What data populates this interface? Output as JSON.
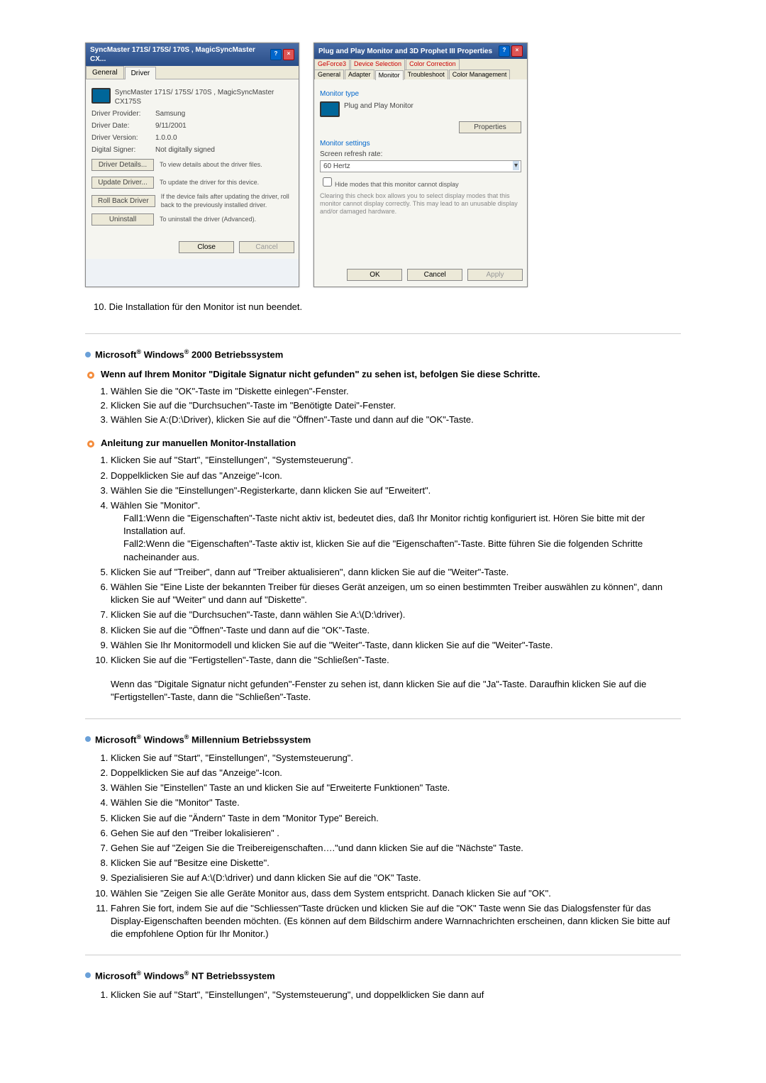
{
  "dialog1": {
    "title": "SyncMaster 171S/ 175S/ 170S , MagicSyncMaster CX...",
    "tabs": [
      "General",
      "Driver"
    ],
    "model": "SyncMaster 171S/ 175S/ 170S , MagicSyncMaster CX175S",
    "provider_lbl": "Driver Provider:",
    "provider_val": "Samsung",
    "date_lbl": "Driver Date:",
    "date_val": "9/11/2001",
    "version_lbl": "Driver Version:",
    "version_val": "1.0.0.0",
    "signer_lbl": "Digital Signer:",
    "signer_val": "Not digitally signed",
    "btn_details": "Driver Details...",
    "btn_details_desc": "To view details about the driver files.",
    "btn_update": "Update Driver...",
    "btn_update_desc": "To update the driver for this device.",
    "btn_rollback": "Roll Back Driver",
    "btn_rollback_desc": "If the device fails after updating the driver, roll back to the previously installed driver.",
    "btn_uninstall": "Uninstall",
    "btn_uninstall_desc": "To uninstall the driver (Advanced).",
    "btn_close": "Close",
    "btn_cancel": "Cancel"
  },
  "dialog2": {
    "title": "Plug and Play Monitor and 3D Prophet III Properties",
    "tabs_row1": [
      "GeForce3",
      "Device Selection",
      "Color Correction"
    ],
    "tabs_row2": [
      "General",
      "Adapter",
      "Monitor",
      "Troubleshoot",
      "Color Management"
    ],
    "group_monitor_type": "Monitor type",
    "monitor_name": "Plug and Play Monitor",
    "btn_properties": "Properties",
    "group_settings": "Monitor settings",
    "refresh_lbl": "Screen refresh rate:",
    "refresh_val": "60 Hertz",
    "hide_modes": "Hide modes that this monitor cannot display",
    "hint": "Clearing this check box allows you to select display modes that this monitor cannot display correctly. This may lead to an unusable display and/or damaged hardware.",
    "btn_ok": "OK",
    "btn_cancel": "Cancel",
    "btn_apply": "Apply"
  },
  "step10": "10.   Die Installation für den Monitor ist nun beendet.",
  "sec2000": {
    "heading_pre": "Microsoft",
    "heading_mid": " Windows",
    "heading_post": " 2000 Betriebssystem",
    "sub1": "Wenn auf Ihrem Monitor \"Digitale Signatur nicht gefunden\" zu sehen ist, befolgen Sie diese Schritte.",
    "s1": [
      "Wählen Sie die \"OK\"-Taste im \"Diskette einlegen\"-Fenster.",
      "Klicken Sie auf die \"Durchsuchen\"-Taste im \"Benötigte Datei\"-Fenster.",
      "Wählen Sie A:(D:\\Driver), klicken Sie auf die \"Öffnen\"-Taste und dann auf die \"OK\"-Taste."
    ],
    "sub2": "Anleitung zur manuellen Monitor-Installation",
    "s2_1": "Klicken Sie auf \"Start\", \"Einstellungen\", \"Systemsteuerung\".",
    "s2_2": "Doppelklicken Sie auf das \"Anzeige\"-Icon.",
    "s2_3": "Wählen Sie die \"Einstellungen\"-Registerkarte, dann klicken Sie auf \"Erweitert\".",
    "s2_4": "Wählen Sie \"Monitor\".",
    "fall1_lbl": "Fall1:",
    "fall1": "Wenn die \"Eigenschaften\"-Taste nicht aktiv ist, bedeutet dies, daß Ihr Monitor richtig konfiguriert ist. Hören Sie bitte mit der Installation auf.",
    "fall2_lbl": "Fall2:",
    "fall2": "Wenn die \"Eigenschaften\"-Taste aktiv ist, klicken Sie auf die \"Eigenschaften\"-Taste. Bitte führen Sie die folgenden Schritte nacheinander aus.",
    "s2_5": "Klicken Sie auf \"Treiber\", dann auf \"Treiber aktualisieren\", dann klicken Sie auf die \"Weiter\"-Taste.",
    "s2_6": "Wählen Sie \"Eine Liste der bekannten Treiber für dieses Gerät anzeigen, um so einen bestimmten Treiber auswählen zu können\", dann klicken Sie auf \"Weiter\" und dann auf \"Diskette\".",
    "s2_7": "Klicken Sie auf die \"Durchsuchen\"-Taste, dann wählen Sie A:\\(D:\\driver).",
    "s2_8": "Klicken Sie auf die \"Öffnen\"-Taste und dann auf die \"OK\"-Taste.",
    "s2_9": "Wählen Sie Ihr Monitormodell und klicken Sie auf die \"Weiter\"-Taste, dann klicken Sie auf die \"Weiter\"-Taste.",
    "s2_10": "Klicken Sie auf die \"Fertigstellen\"-Taste, dann die \"Schließen\"-Taste.",
    "s2_after": "Wenn das \"Digitale Signatur nicht gefunden\"-Fenster zu sehen ist, dann klicken Sie auf die \"Ja\"-Taste. Daraufhin klicken Sie auf die \"Fertigstellen\"-Taste, dann die \"Schließen\"-Taste."
  },
  "secME": {
    "heading_post": " Millennium Betriebssystem",
    "s": [
      "Klicken Sie auf \"Start\", \"Einstellungen\", \"Systemsteuerung\".",
      "Doppelklicken Sie auf das \"Anzeige\"-Icon.",
      "Wählen Sie \"Einstellen\" Taste an und klicken Sie auf \"Erweiterte Funktionen\" Taste.",
      "Wählen Sie die \"Monitor\" Taste.",
      "Klicken Sie auf die \"Ändern\" Taste in dem \"Monitor Type\" Bereich.",
      "Gehen Sie auf den \"Treiber lokalisieren\" .",
      "Gehen Sie auf \"Zeigen Sie die Treibereigenschaften….\"und dann klicken Sie auf die \"Nächste\" Taste.",
      "Klicken Sie auf \"Besitze eine Diskette\".",
      "Spezialisieren Sie auf A:\\(D:\\driver) und dann klicken Sie auf die \"OK\" Taste.",
      "Wählen Sie \"Zeigen Sie alle Geräte Monitor aus, dass dem System entspricht. Danach klicken Sie auf \"OK\".",
      "Fahren Sie fort, indem Sie auf die \"Schliessen\"Taste drücken und klicken Sie auf die \"OK\" Taste wenn Sie das Dialogsfenster für das Display-Eigenschaften beenden möchten. (Es können auf dem Bildschirm andere Warnnachrichten erscheinen, dann klicken Sie bitte auf die empfohlene Option für Ihr Monitor.)"
    ]
  },
  "secNT": {
    "heading_post": " NT Betriebssystem",
    "s1": "Klicken Sie auf \"Start\", \"Einstellungen\", \"Systemsteuerung\", und doppelklicken Sie dann auf"
  }
}
